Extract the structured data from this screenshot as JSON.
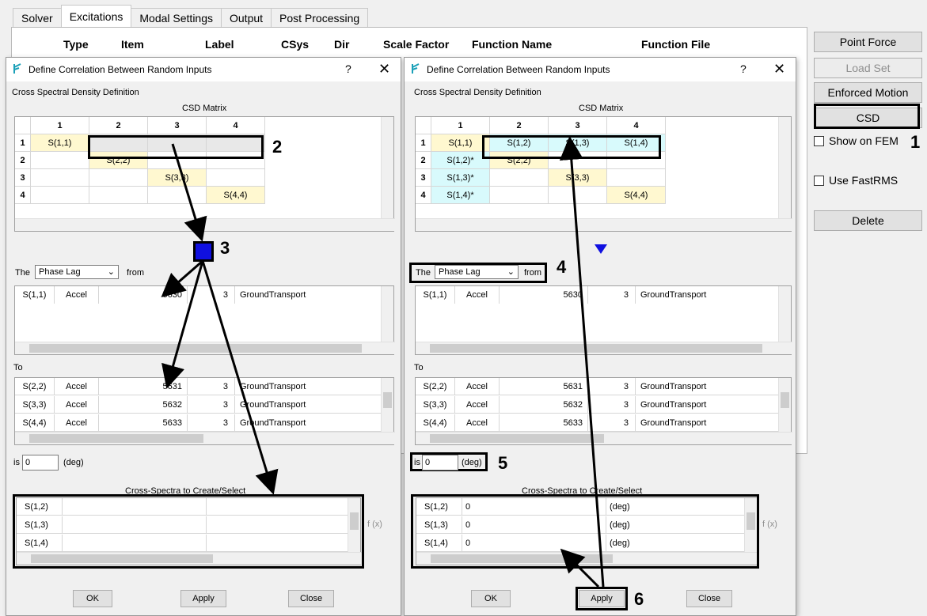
{
  "tabs": [
    "Solver",
    "Excitations",
    "Modal Settings",
    "Output",
    "Post Processing"
  ],
  "table_headers": [
    "Type",
    "Item",
    "Label",
    "CSys",
    "Dir",
    "Scale Factor",
    "Function Name",
    "Function File"
  ],
  "right_panel": {
    "point_force": "Point Force",
    "load_set": "Load Set",
    "enforced_motion": "Enforced Motion",
    "csd": "CSD",
    "show_on_fem": "Show on FEM",
    "use_fastrms": "Use FastRMS",
    "delete": "Delete"
  },
  "dialog": {
    "title": "Define Correlation Between Random Inputs",
    "help": "?",
    "close_x": "✕",
    "section": "Cross Spectral Density Definition",
    "matrix_title": "CSD Matrix",
    "col_headers": [
      "1",
      "2",
      "3",
      "4"
    ],
    "row_headers": [
      "1",
      "2",
      "3",
      "4"
    ],
    "the_label": "The",
    "from_label": "from",
    "phase_option": "Phase Lag",
    "to_label": "To",
    "is_label": "is",
    "deg_label": "(deg)",
    "is_value": "0",
    "cross_title": "Cross-Spectra to Create/Select",
    "fx": "f (x)",
    "ok": "OK",
    "apply": "Apply",
    "close": "Close",
    "from_row": [
      "S(1,1)",
      "Accel",
      "5630",
      "3",
      "GroundTransport"
    ],
    "to_rows": [
      [
        "S(2,2)",
        "Accel",
        "5631",
        "3",
        "GroundTransport"
      ],
      [
        "S(3,3)",
        "Accel",
        "5632",
        "3",
        "GroundTransport"
      ],
      [
        "S(4,4)",
        "Accel",
        "5633",
        "3",
        "GroundTransport"
      ]
    ]
  },
  "left": {
    "diag": [
      "S(1,1)",
      "S(2,2)",
      "S(3,3)",
      "S(4,4)"
    ],
    "cross_rows": [
      "S(1,2)",
      "S(1,3)",
      "S(1,4)"
    ]
  },
  "right": {
    "row1": [
      "S(1,1)",
      "S(1,2)",
      "S(1,3)",
      "S(1,4)"
    ],
    "col1": [
      "S(1,2)*",
      "S(1,3)*",
      "S(1,4)*"
    ],
    "diag": [
      "S(2,2)",
      "S(3,3)",
      "S(4,4)"
    ],
    "cross_rows": [
      [
        "S(1,2)",
        "0",
        "(deg)"
      ],
      [
        "S(1,3)",
        "0",
        "(deg)"
      ],
      [
        "S(1,4)",
        "0",
        "(deg)"
      ]
    ]
  },
  "callouts": [
    "1",
    "2",
    "3",
    "4",
    "5",
    "6"
  ],
  "colors": {
    "highlight_yellow": "#fff8d0",
    "highlight_cyan": "#d8fafc",
    "down_arrow": "#1010e0"
  }
}
